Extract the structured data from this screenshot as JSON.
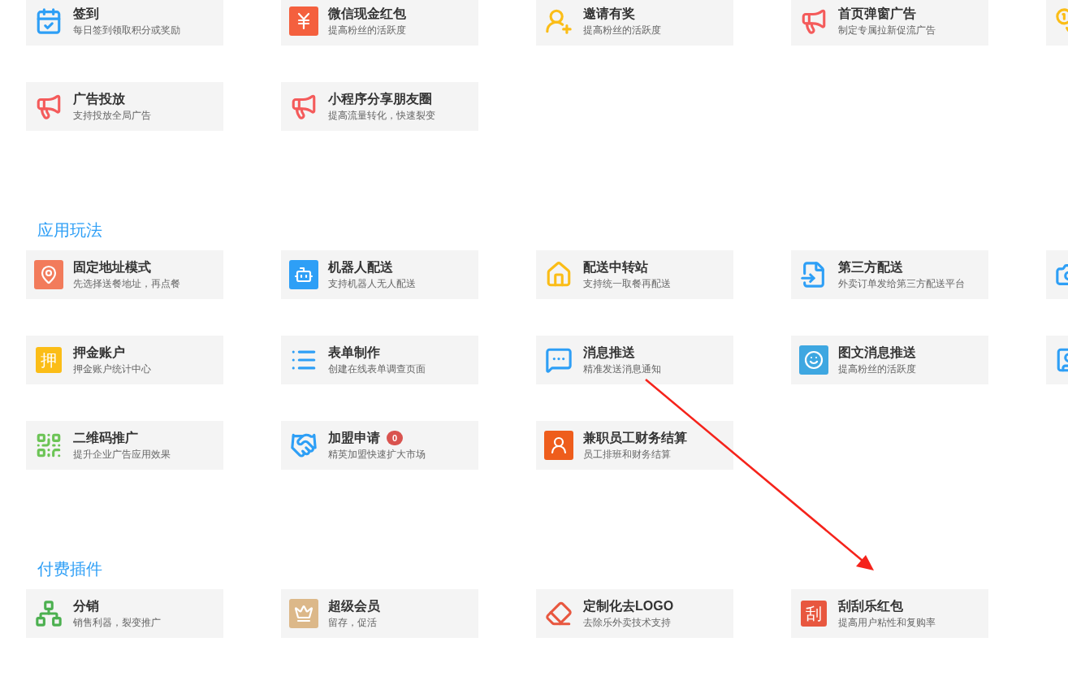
{
  "sections": [
    {
      "rows": [
        [
          {
            "title": "签到",
            "desc": "每日签到领取积分或奖励"
          },
          {
            "title": "微信现金红包",
            "desc": "提高粉丝的活跃度"
          },
          {
            "title": "邀请有奖",
            "desc": "提高粉丝的活跃度"
          },
          {
            "title": "首页弹窗广告",
            "desc": "制定专属拉新促流广告"
          },
          {
            "partial": true
          }
        ],
        [
          {
            "title": "广告投放",
            "desc": "支持投放全局广告"
          },
          {
            "title": "小程序分享朋友圈",
            "desc": "提高流量转化，快速裂变"
          }
        ]
      ]
    },
    {
      "title": "应用玩法",
      "rows": [
        [
          {
            "title": "固定地址模式",
            "desc": "先选择送餐地址，再点餐"
          },
          {
            "title": "机器人配送",
            "desc": "支持机器人无人配送"
          },
          {
            "title": "配送中转站",
            "desc": "支持统一取餐再配送"
          },
          {
            "title": "第三方配送",
            "desc": "外卖订单发给第三方配送平台"
          },
          {
            "partial": true
          }
        ],
        [
          {
            "title": "押金账户",
            "desc": "押金账户统计中心",
            "icon_char": "押"
          },
          {
            "title": "表单制作",
            "desc": "创建在线表单调查页面"
          },
          {
            "title": "消息推送",
            "desc": "精准发送消息通知"
          },
          {
            "title": "图文消息推送",
            "desc": "提高粉丝的活跃度"
          },
          {
            "partial": true
          }
        ],
        [
          {
            "title": "二维码推广",
            "desc": "提升企业广告应用效果"
          },
          {
            "title": "加盟申请",
            "desc": "精英加盟快速扩大市场",
            "badge": "0"
          },
          {
            "title": "兼职员工财务结算",
            "desc": "员工排班和财务结算"
          }
        ]
      ]
    },
    {
      "title": "付费插件",
      "rows": [
        [
          {
            "title": "分销",
            "desc": "销售利器，裂变推广"
          },
          {
            "title": "超级会员",
            "desc": "留存，促活"
          },
          {
            "title": "定制化去LOGO",
            "desc": "去除乐外卖技术支持"
          },
          {
            "title": "刮刮乐红包",
            "desc": "提高用户粘性和复购率",
            "icon_char": "刮"
          }
        ]
      ]
    }
  ]
}
